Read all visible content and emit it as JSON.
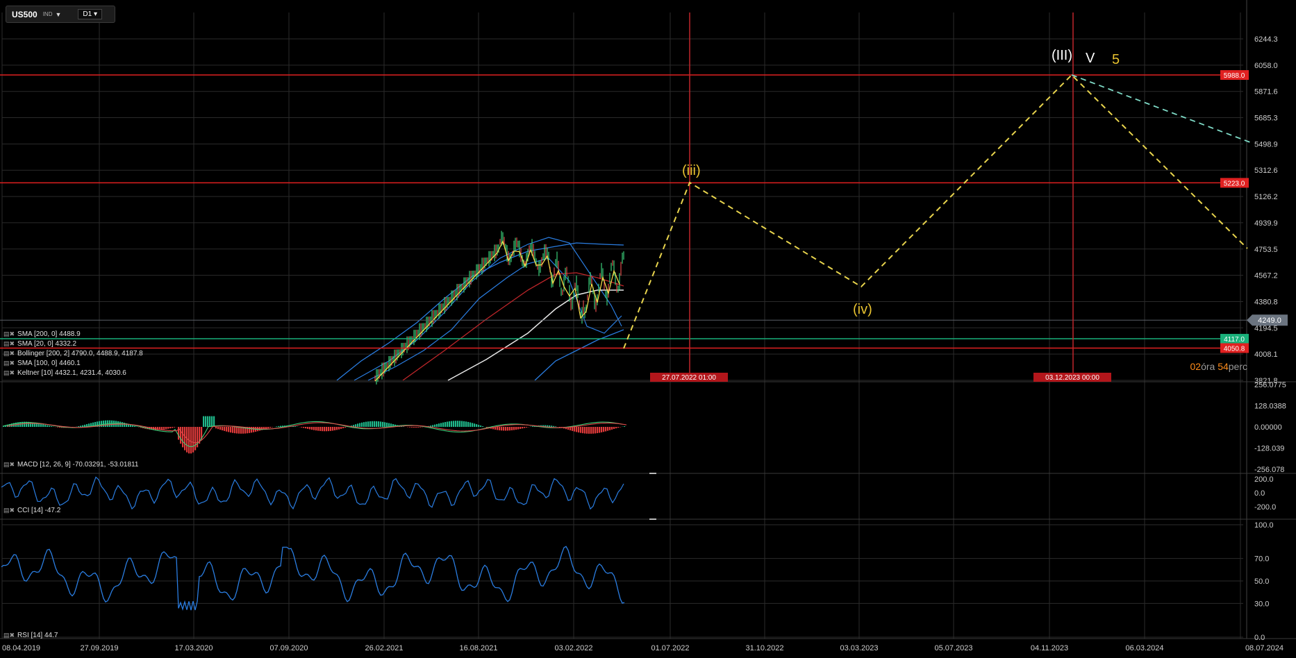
{
  "toolbar": {
    "symbol": "US500",
    "type": "IND",
    "timeframe": "D1"
  },
  "price_axis": {
    "ticks": [
      "6244.3",
      "6058.0",
      "5871.6",
      "5685.3",
      "5498.9",
      "5312.6",
      "5126.2",
      "4939.9",
      "4753.5",
      "4567.2",
      "4380.8",
      "4194.5",
      "4008.1",
      "3821.8"
    ],
    "current": "4249.0"
  },
  "levels": [
    {
      "label": "5988.0",
      "color": "#e02020"
    },
    {
      "label": "5223.0",
      "color": "#e02020"
    },
    {
      "label": "4117.0",
      "color": "#19b07a"
    },
    {
      "label": "4050.8",
      "color": "#e02020"
    }
  ],
  "vertical_markers": [
    {
      "label": "27.07.2022 01:00"
    },
    {
      "label": "03.12.2023 00:00"
    }
  ],
  "wave_labels": [
    {
      "text": "(iii)",
      "color": "#e8c230"
    },
    {
      "text": "(iv)",
      "color": "#e8c230"
    },
    {
      "text": "(III)",
      "color": "#ffffff"
    },
    {
      "text": "V",
      "color": "#ffffff"
    },
    {
      "text": "5",
      "color": "#e8c230"
    }
  ],
  "indicators": [
    {
      "name": "SMA [200, 0] 4488.9"
    },
    {
      "name": "SMA [20, 0] 4332.2"
    },
    {
      "name": "Bollinger [200, 2] 4790.0, 4488.9, 4187.8"
    },
    {
      "name": "SMA [100, 0] 4460.1"
    },
    {
      "name": "Keltner [10] 4432.1, 4231.4, 4030.6"
    }
  ],
  "macd": {
    "label": "MACD [12, 26, 9] -70.03291, -53.01811",
    "ticks": [
      "256.0775",
      "128.0388",
      "0.00000",
      "-128.039",
      "-256.078"
    ]
  },
  "cci": {
    "label": "CCI [14] -47.2",
    "ticks": [
      "200.0",
      "0.0",
      "-200.0"
    ]
  },
  "rsi": {
    "label": "RSI [14] 44.7",
    "ticks": [
      "100.0",
      "70.0",
      "50.0",
      "30.0",
      "0.0"
    ]
  },
  "time_axis": [
    "08.04.2019",
    "27.09.2019",
    "17.03.2020",
    "07.09.2020",
    "26.02.2021",
    "16.08.2021",
    "03.02.2022",
    "01.07.2022",
    "31.10.2022",
    "03.03.2023",
    "05.07.2023",
    "04.11.2023",
    "06.03.2024",
    "08.07.2024"
  ],
  "countdown": {
    "hours": "02",
    "hours_label": "óra",
    "minutes": "54",
    "minutes_label": "perc"
  },
  "colors": {
    "grid": "#2b2b2b",
    "wave": "#e8d44d",
    "projection_alt": "#7fdcc8",
    "indicator_blue": "#2a7de1",
    "macd_hist_pos": "#1fb88a",
    "macd_hist_neg": "#e03a3a"
  }
}
